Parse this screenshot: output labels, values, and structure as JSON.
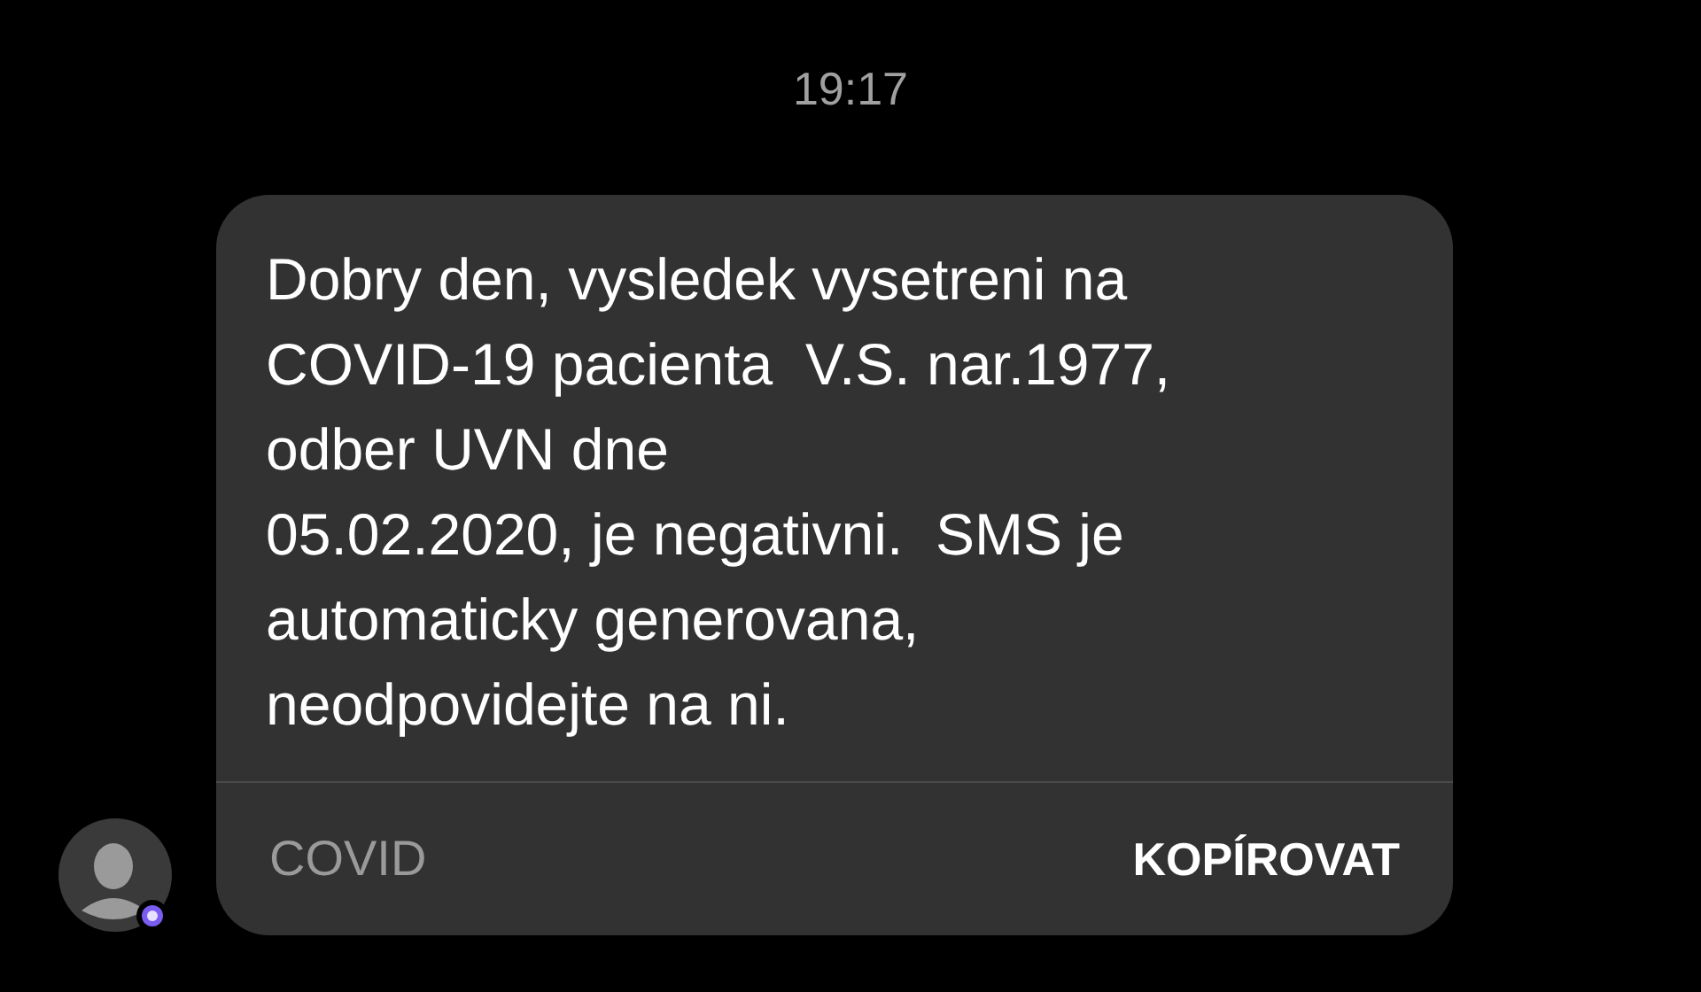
{
  "time": "19:17",
  "message": {
    "lines": [
      "Dobry den, vysledek vysetreni na",
      "COVID-19 pacienta  V.S. nar.1977,",
      "odber UVN dne",
      "05.02.2020, je negativni.  SMS je",
      "automaticky generovana,",
      "neodpovidejte na ni."
    ],
    "sender": "COVID",
    "action": "KOPÍROVAT"
  }
}
